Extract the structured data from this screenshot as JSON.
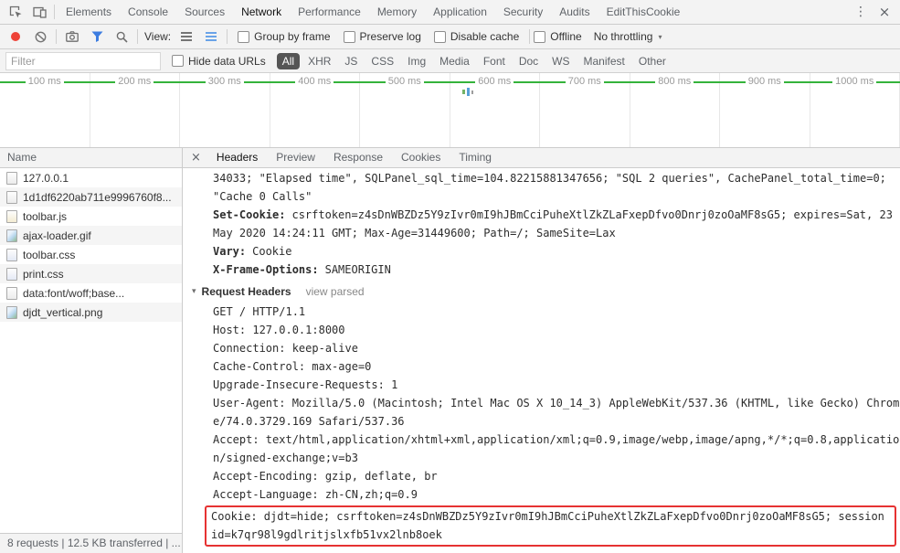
{
  "colors": {
    "overview_line_green": "#35b33b",
    "record_red": "#ee4237",
    "filter_funnel_blue": "#3d7de0",
    "cookie_highlight_red": "#e63232",
    "active_type_pill_bg": "#555555"
  },
  "icons": {
    "kebab_menu": "⋮",
    "close_window": "×",
    "details_close": "×",
    "request_headers_disclosure": "▾",
    "throttling_dropdown_arrow": "▾"
  },
  "panel_tabs": {
    "items": [
      "Elements",
      "Console",
      "Sources",
      "Network",
      "Performance",
      "Memory",
      "Application",
      "Security",
      "Audits",
      "EditThisCookie"
    ],
    "active": "Network"
  },
  "toolbar": {
    "view_label": "View:",
    "checkboxes": [
      "Group by frame",
      "Preserve log",
      "Disable cache"
    ],
    "offline_label": "Offline",
    "throttling_value": "No throttling"
  },
  "filter_bar": {
    "filter_placeholder": "Filter",
    "hide_data_urls_label": "Hide data URLs",
    "types": [
      "All",
      "XHR",
      "JS",
      "CSS",
      "Img",
      "Media",
      "Font",
      "Doc",
      "WS",
      "Manifest",
      "Other"
    ],
    "active_type": "All"
  },
  "overview": {
    "ticks": [
      "100 ms",
      "200 ms",
      "300 ms",
      "400 ms",
      "500 ms",
      "600 ms",
      "700 ms",
      "800 ms",
      "900 ms",
      "1000 ms"
    ]
  },
  "requests": {
    "column_header": "Name",
    "rows": [
      {
        "name": "127.0.0.1",
        "icon": "document-icon"
      },
      {
        "name": "1d1df6220ab711e9996760f8...",
        "icon": "document-icon"
      },
      {
        "name": "toolbar.js",
        "icon": "script-icon"
      },
      {
        "name": "ajax-loader.gif",
        "icon": "image-icon"
      },
      {
        "name": "toolbar.css",
        "icon": "stylesheet-icon"
      },
      {
        "name": "print.css",
        "icon": "stylesheet-icon"
      },
      {
        "name": "data:font/woff;base...",
        "icon": "font-icon"
      },
      {
        "name": "djdt_vertical.png",
        "icon": "image-icon"
      }
    ]
  },
  "details": {
    "tabs": [
      "Headers",
      "Preview",
      "Response",
      "Cookies",
      "Timing"
    ],
    "active_tab": "Headers",
    "headers_view": {
      "server_timing_tail": "34033; \"Elapsed time\", SQLPanel_sql_time=104.82215881347656; \"SQL 2 queries\", CachePanel_total_time=0; \"Cache 0 Calls\"",
      "response_headers": [
        {
          "key": "Set-Cookie:",
          "value": "csrftoken=z4sDnWBZDz5Y9zIvr0mI9hJBmCciPuheXtlZkZLaFxepDfvo0Dnrj0zoOaMF8sG5; expires=Sat, 23 May 2020 14:24:11 GMT; Max-Age=31449600; Path=/; SameSite=Lax"
        },
        {
          "key": "Vary:",
          "value": "Cookie"
        },
        {
          "key": "X-Frame-Options:",
          "value": "SAMEORIGIN"
        }
      ],
      "request_headers_title": "Request Headers",
      "view_parsed_label": "view parsed",
      "raw_request_headers": [
        "GET / HTTP/1.1",
        "Host: 127.0.0.1:8000",
        "Connection: keep-alive",
        "Cache-Control: max-age=0",
        "Upgrade-Insecure-Requests: 1",
        "User-Agent: Mozilla/5.0 (Macintosh; Intel Mac OS X 10_14_3) AppleWebKit/537.36 (KHTML, like Gecko) Chrome/74.0.3729.169 Safari/537.36",
        "Accept: text/html,application/xhtml+xml,application/xml;q=0.9,image/webp,image/apng,*/*;q=0.8,application/signed-exchange;v=b3",
        "Accept-Encoding: gzip, deflate, br",
        "Accept-Language: zh-CN,zh;q=0.9"
      ],
      "cookie_header": "Cookie: djdt=hide; csrftoken=z4sDnWBZDz5Y9zIvr0mI9hJBmCciPuheXtlZkZLaFxepDfvo0Dnrj0zoOaMF8sG5; sessionid=k7qr98l9gdlritjslxfb51vx2lnb8oek"
    }
  },
  "status_bar": {
    "summary": "8 requests | 12.5 KB transferred | ..."
  }
}
